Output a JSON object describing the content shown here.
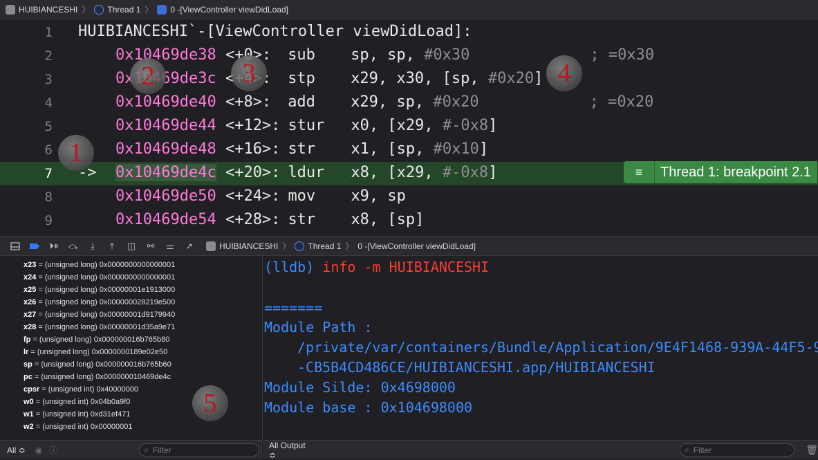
{
  "topbar": {
    "crumbs": [
      "HUIBIANCESHI",
      "Thread 1",
      "0 -[ViewController viewDidLoad]"
    ]
  },
  "editor": {
    "lines": [
      {
        "num": "1",
        "text": "HUIBIANCESHI`-[ViewController viewDidLoad]:"
      },
      {
        "num": "2",
        "addr": "0x10469de38",
        "off": "<+0>:",
        "op": "sub",
        "args": "sp, sp, ",
        "imm": "#0x30",
        "cmt": "; =0x30"
      },
      {
        "num": "3",
        "addr": "0x10469de3c",
        "off": "<+4>:",
        "op": "stp",
        "args": "x29, x30, [sp, ",
        "imm": "#0x20",
        "tail": "]"
      },
      {
        "num": "4",
        "addr": "0x10469de40",
        "off": "<+8>:",
        "op": "add",
        "args": "x29, sp, ",
        "imm": "#0x20",
        "cmt": "; =0x20"
      },
      {
        "num": "5",
        "addr": "0x10469de44",
        "off": "<+12>:",
        "op": "stur",
        "args": "x0, [x29, ",
        "imm": "#-0x8",
        "tail": "]"
      },
      {
        "num": "6",
        "addr": "0x10469de48",
        "off": "<+16>:",
        "op": "str",
        "args": "x1, [sp, ",
        "imm": "#0x10",
        "tail": "]"
      },
      {
        "num": "7",
        "arrow": "->",
        "addr": "0x10469de4c",
        "off": "<+20>:",
        "op": "ldur",
        "args": "x8, [x29, ",
        "imm": "#-0x8",
        "tail": "]"
      },
      {
        "num": "8",
        "addr": "0x10469de50",
        "off": "<+24>:",
        "op": "mov",
        "args": "x9, sp"
      },
      {
        "num": "9",
        "addr": "0x10469de54",
        "off": "<+28>:",
        "op": "str",
        "args": "x8, [sp]"
      }
    ],
    "breakpoint_badge": "Thread 1: breakpoint 2.1"
  },
  "debugbar": {
    "crumbs": [
      "HUIBIANCESHI",
      "Thread 1",
      "0 -[ViewController viewDidLoad]"
    ]
  },
  "variables": [
    {
      "name": "x23",
      "rest": " = (unsigned long) 0x0000000000000001"
    },
    {
      "name": "x24",
      "rest": " = (unsigned long) 0x0000000000000001"
    },
    {
      "name": "x25",
      "rest": " = (unsigned long) 0x00000001e1913000"
    },
    {
      "name": "x26",
      "rest": " = (unsigned long) 0x000000028219e500"
    },
    {
      "name": "x27",
      "rest": " = (unsigned long) 0x00000001d9179940"
    },
    {
      "name": "x28",
      "rest": " = (unsigned long) 0x00000001d35a9e71"
    },
    {
      "name": "fp",
      "rest": " = (unsigned long) 0x000000016b765b80"
    },
    {
      "name": "lr",
      "rest": " = (unsigned long) 0x0000000189e02e50"
    },
    {
      "name": "sp",
      "rest": " = (unsigned long) 0x000000016b765b60"
    },
    {
      "name": "pc",
      "rest": " = (unsigned long) 0x000000010469de4c"
    },
    {
      "name": "cpsr",
      "rest": " = (unsigned int) 0x40000000"
    },
    {
      "name": "w0",
      "rest": " = (unsigned int) 0x04b0a9f0"
    },
    {
      "name": "w1",
      "rest": " = (unsigned int) 0xd31ef471"
    },
    {
      "name": "w2",
      "rest": " = (unsigned int) 0x00000001"
    }
  ],
  "console": {
    "prompt": "(lldb) ",
    "command": "info -m HUIBIANCESHI",
    "separator": "=======",
    "path_label": "Module Path :",
    "path_line1": "/private/var/containers/Bundle/Application/9E4F1468-939A-44F5-9",
    "path_line2": "-CB5B4CD486CE/HUIBIANCESHI.app/HUIBIANCESHI",
    "slide": "Module Silde: 0x4698000",
    "base": "Module base : 0x104698000"
  },
  "bottom": {
    "scope_left": "All ≎",
    "filter_placeholder": "Filter",
    "output_scope": "All Output ≎"
  },
  "markers": [
    "1",
    "2",
    "3",
    "4",
    "5"
  ]
}
